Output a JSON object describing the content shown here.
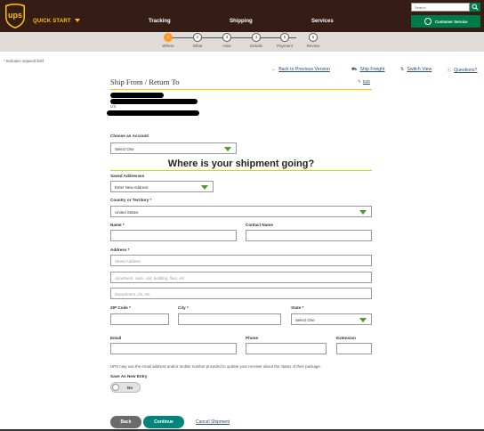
{
  "header": {
    "logo_text": "ups",
    "quick_start": "QUICK START",
    "nav": [
      "Tracking",
      "Shipping",
      "Services"
    ],
    "search_placeholder": "Search",
    "customer_service": "Customer Service"
  },
  "progress": {
    "steps": [
      {
        "num": "1",
        "label": "Where",
        "active": true
      },
      {
        "num": "2",
        "label": "What",
        "active": false
      },
      {
        "num": "3",
        "label": "How",
        "active": false
      },
      {
        "num": "4",
        "label": "Details",
        "active": false
      },
      {
        "num": "5",
        "label": "Payment",
        "active": false
      },
      {
        "num": "6",
        "label": "Review",
        "active": false
      }
    ]
  },
  "page": {
    "required_note": "* Indicates required field",
    "links": {
      "back_to_prev": "Back to Previous Version",
      "ship_freight": "Ship Freight",
      "switch_view": "Switch View",
      "questions": "Questions?"
    }
  },
  "ship_from": {
    "title": "Ship From / Return To",
    "edit": "Edit",
    "country": "US"
  },
  "account": {
    "label": "Choose an Account",
    "value": "Select One"
  },
  "destination": {
    "heading": "Where is your shipment going?",
    "saved_label": "Saved Addresses",
    "saved_value": "Enter New Address",
    "country_label": "Country or Territory *",
    "country_value": "United States",
    "name_label": "Name *",
    "contact_label": "Contact Name",
    "address_label": "Address *",
    "street_ph": "Street Address",
    "apt_ph": "Apartment, suite, unit, building, floor, etc.",
    "dept_ph": "Department, c/o, etc.",
    "zip_label": "ZIP Code *",
    "city_label": "City *",
    "state_label": "State *",
    "state_value": "Select One",
    "email_label": "Email",
    "phone_label": "Phone",
    "ext_label": "Extension",
    "privacy_note": "UPS may use the email address and/or mobile number provided to update your receiver about the status of their package.",
    "save_label": "Save As New Entry",
    "save_value": "No"
  },
  "actions": {
    "back": "Back",
    "continue": "Continue",
    "cancel": "Cancel Shipment"
  },
  "colors": {
    "brand_brown": "#351c15",
    "brand_gold": "#ffc400",
    "active_step": "#ff9a1e",
    "primary_green": "#00857d"
  }
}
